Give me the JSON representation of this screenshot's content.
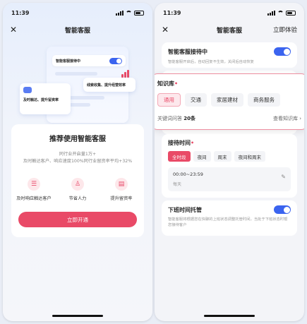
{
  "status": {
    "time": "11:39"
  },
  "left": {
    "nav": {
      "title": "智能客服"
    },
    "illustration": {
      "toggle_label": "智能客服接待中",
      "card_a_text": "及时触达、提升留资率",
      "card_b_text": "线索收集、提升经营效率"
    },
    "promo": {
      "title": "推荐使用智能客服",
      "desc_line1": "同行业开启量1万+",
      "desc_line2": "及时触达客户、响应速度100%同行业留资率平均+32%",
      "features": [
        {
          "label": "及时响应触达客户",
          "icon": "chat-bubble-icon"
        },
        {
          "label": "节省人力",
          "icon": "person-icon"
        },
        {
          "label": "提升留资率",
          "icon": "document-icon"
        }
      ],
      "cta": "立即开通"
    }
  },
  "right": {
    "nav": {
      "title": "智能客服",
      "action": "立即体验"
    },
    "reception": {
      "title": "智能客服接待中",
      "sub": "智能客服开启后，自动回复不生效，关闭后自动恢复",
      "on": true
    },
    "knowledge": {
      "title": "知识库",
      "chips": [
        "通用",
        "交通",
        "家居建材",
        "商务服务"
      ],
      "active_index": 0,
      "keyword_label": "关键词问答",
      "keyword_count": "20条",
      "view_link": "查看知识库"
    },
    "reception_time": {
      "title": "接待时间",
      "options": [
        "全时段",
        "夜间",
        "周末",
        "夜间和周末"
      ],
      "active_index": 0,
      "range": "00:00~23:59",
      "days": "每天"
    },
    "off_hours": {
      "title": "下班时间托管",
      "sub": "智能客服将根据您在快聊的上班状态调整托管时间，当处于下班状态时帮您接待客户",
      "on": true
    }
  },
  "colors": {
    "accent": "#e94a67",
    "toggle": "#3b64ef"
  }
}
